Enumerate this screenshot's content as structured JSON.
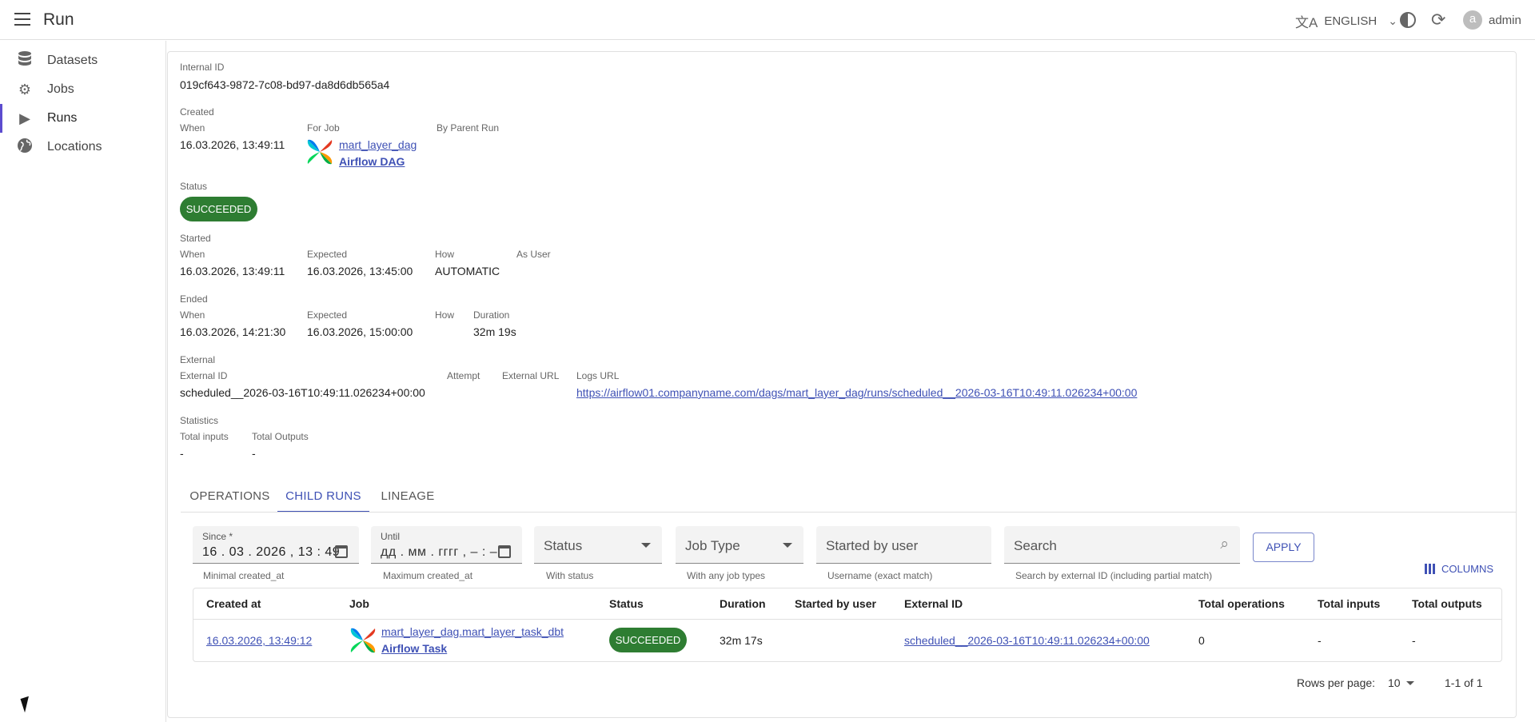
{
  "app": {
    "title": "Run",
    "language": "ENGLISH",
    "username": "admin",
    "avatar_letter": "a"
  },
  "sidebar": {
    "items": [
      {
        "label": "Datasets",
        "icon": "database-icon"
      },
      {
        "label": "Jobs",
        "icon": "gear-icon"
      },
      {
        "label": "Runs",
        "icon": "play-icon",
        "active": true
      },
      {
        "label": "Locations",
        "icon": "globe-icon"
      }
    ]
  },
  "run": {
    "internal_id_label": "Internal ID",
    "internal_id": "019cf643-9872-7c08-bd97-da8d6db565a4",
    "created": {
      "section": "Created",
      "when_label": "When",
      "when": "16.03.2026, 13:49:11",
      "for_job_label": "For Job",
      "job_name": "mart_layer_dag",
      "job_type": "Airflow DAG",
      "parent_label": "By Parent Run"
    },
    "status": {
      "section": "Status",
      "value": "SUCCEEDED",
      "color": "#2e7d32"
    },
    "started": {
      "section": "Started",
      "when_label": "When",
      "when": "16.03.2026, 13:49:11",
      "expected_label": "Expected",
      "expected": "16.03.2026, 13:45:00",
      "how_label": "How",
      "how": "AUTOMATIC",
      "as_user_label": "As User"
    },
    "ended": {
      "section": "Ended",
      "when_label": "When",
      "when": "16.03.2026, 14:21:30",
      "expected_label": "Expected",
      "expected": "16.03.2026, 15:00:00",
      "how_label": "How",
      "duration_label": "Duration",
      "duration": "32m 19s"
    },
    "external": {
      "section": "External",
      "external_id_label": "External ID",
      "external_id": "scheduled__2026-03-16T10:49:11.026234+00:00",
      "attempt_label": "Attempt",
      "external_url_label": "External URL",
      "logs_url_label": "Logs URL",
      "logs_url": "https://airflow01.companyname.com/dags/mart_layer_dag/runs/scheduled__2026-03-16T10:49:11.026234+00:00"
    },
    "statistics": {
      "section": "Statistics",
      "total_inputs_label": "Total inputs",
      "total_inputs": "-",
      "total_outputs_label": "Total Outputs",
      "total_outputs": "-"
    }
  },
  "tabs": [
    {
      "label": "OPERATIONS"
    },
    {
      "label": "CHILD RUNS",
      "active": true
    },
    {
      "label": "LINEAGE"
    }
  ],
  "filters": {
    "since": {
      "label": "Since *",
      "value": "16 . 03 . 2026 ,  13 : 49",
      "helper": "Minimal created_at"
    },
    "until": {
      "label": "Until",
      "value": "дд . мм . гггг ,  – : –",
      "helper": "Maximum created_at"
    },
    "status": {
      "placeholder": "Status",
      "helper": "With status"
    },
    "job_type": {
      "placeholder": "Job Type",
      "helper": "With any job types"
    },
    "started_by": {
      "placeholder": "Started by user",
      "helper": "Username (exact match)"
    },
    "search": {
      "placeholder": "Search",
      "helper": "Search by external ID (including partial match)"
    },
    "apply_label": "APPLY",
    "columns_label": "COLUMNS"
  },
  "table": {
    "headers": [
      "Created at",
      "Job",
      "Status",
      "Duration",
      "Started by user",
      "External ID",
      "Total operations",
      "Total inputs",
      "Total outputs"
    ],
    "rows": [
      {
        "created_at": "16.03.2026, 13:49:12",
        "job_name": "mart_layer_dag.mart_layer_task_dbt",
        "job_type": "Airflow Task",
        "status": "SUCCEEDED",
        "duration": "32m 17s",
        "started_by": "",
        "external_id": "scheduled__2026-03-16T10:49:11.026234+00:00",
        "total_operations": "0",
        "total_inputs": "-",
        "total_outputs": "-"
      }
    ]
  },
  "pagination": {
    "rows_per_page_label": "Rows per page:",
    "rows_per_page": "10",
    "range": "1-1 of 1"
  }
}
